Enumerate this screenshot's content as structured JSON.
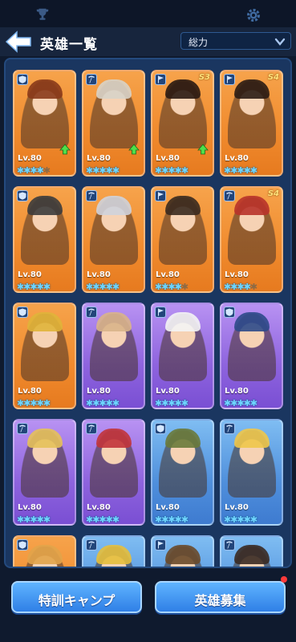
{
  "header": {
    "title": "英雄一覧",
    "sort_value": "総力"
  },
  "heroes": [
    {
      "lv": "Lv.80",
      "tier": "",
      "color": "orange",
      "role": "shield",
      "stars": 4,
      "hair": "#8a3a1a",
      "badge": true
    },
    {
      "lv": "Lv.80",
      "tier": "",
      "color": "orange",
      "role": "pick",
      "stars": 5,
      "hair": "#d8d3c8",
      "badge": true
    },
    {
      "lv": "Lv.80",
      "tier": "S3",
      "color": "orange",
      "role": "flag",
      "stars": 5,
      "hair": "#2a1a12",
      "badge": true
    },
    {
      "lv": "Lv.80",
      "tier": "S4",
      "color": "orange",
      "role": "flag",
      "stars": 5,
      "hair": "#2b1c14",
      "badge": false
    },
    {
      "lv": "Lv.80",
      "tier": "",
      "color": "orange",
      "role": "shield",
      "stars": 5,
      "hair": "#3c3c3c",
      "badge": false
    },
    {
      "lv": "Lv.80",
      "tier": "",
      "color": "orange",
      "role": "pick",
      "stars": 5,
      "hair": "#cfd3dc",
      "badge": false
    },
    {
      "lv": "Lv.80",
      "tier": "",
      "color": "orange",
      "role": "flag",
      "stars": 4,
      "hair": "#3a2a1f",
      "badge": false
    },
    {
      "lv": "Lv.80",
      "tier": "S4",
      "color": "orange",
      "role": "pick",
      "stars": 4,
      "hair": "#b8332a",
      "badge": false
    },
    {
      "lv": "Lv.80",
      "tier": "",
      "color": "orange",
      "role": "shield",
      "stars": 5,
      "hair": "#e0b43a",
      "badge": false
    },
    {
      "lv": "Lv.80",
      "tier": "",
      "color": "purple",
      "role": "pick",
      "stars": 5,
      "hair": "#d9b48a",
      "badge": false
    },
    {
      "lv": "Lv.80",
      "tier": "",
      "color": "purple",
      "role": "flag",
      "stars": 5,
      "hair": "#f4f4f4",
      "badge": false
    },
    {
      "lv": "Lv.80",
      "tier": "",
      "color": "purple",
      "role": "shield",
      "stars": 5,
      "hair": "#2e4a8a",
      "badge": false
    },
    {
      "lv": "Lv.80",
      "tier": "",
      "color": "purple",
      "role": "pick",
      "stars": 5,
      "hair": "#e6c15a",
      "badge": false
    },
    {
      "lv": "Lv.80",
      "tier": "",
      "color": "purple",
      "role": "pick",
      "stars": 5,
      "hair": "#c2343a",
      "badge": false
    },
    {
      "lv": "Lv.80",
      "tier": "",
      "color": "blue",
      "role": "shield",
      "stars": 5,
      "hair": "#6a7a3a",
      "badge": false
    },
    {
      "lv": "Lv.80",
      "tier": "",
      "color": "blue",
      "role": "pick",
      "stars": 5,
      "hair": "#f0c64a",
      "badge": false
    },
    {
      "lv": "",
      "tier": "",
      "color": "orange",
      "role": "shield",
      "stars": 0,
      "hair": "#e2a44a",
      "badge": false
    },
    {
      "lv": "",
      "tier": "",
      "color": "blue",
      "role": "pick",
      "stars": 0,
      "hair": "#e6bf3c",
      "badge": false
    },
    {
      "lv": "",
      "tier": "",
      "color": "blue",
      "role": "flag",
      "stars": 0,
      "hair": "#6a4a2a",
      "badge": false
    },
    {
      "lv": "",
      "tier": "",
      "color": "blue",
      "role": "pick",
      "stars": 0,
      "hair": "#3a2a22",
      "badge": false
    }
  ],
  "footer": {
    "camp_label": "特訓キャンプ",
    "recruit_label": "英雄募集"
  },
  "colors": {
    "accent": "#2f7fe6",
    "panel": "#1a3660",
    "star": "#6fd6ff",
    "notify": "#ff3a3a"
  }
}
